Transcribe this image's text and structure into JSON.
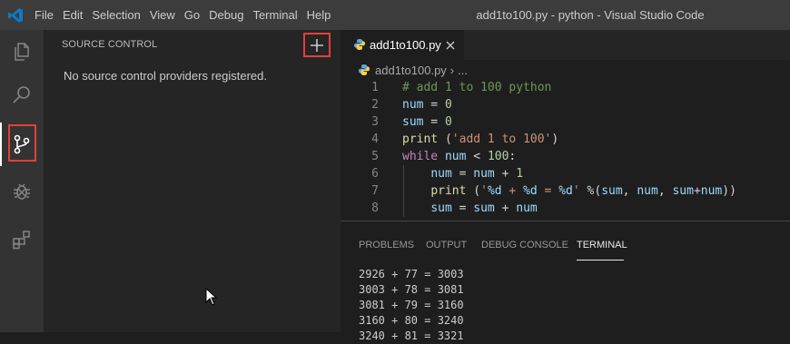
{
  "window": {
    "title": "add1to100.py - python - Visual Studio Code"
  },
  "menu": [
    "File",
    "Edit",
    "Selection",
    "View",
    "Go",
    "Debug",
    "Terminal",
    "Help"
  ],
  "sidebar": {
    "title": "SOURCE CONTROL",
    "message": "No source control providers registered."
  },
  "editor": {
    "tab_label": "add1to100.py",
    "breadcrumb": [
      "add1to100.py",
      "..."
    ],
    "lines": [
      {
        "num": "1",
        "tokens": [
          {
            "t": "# add 1 to 100 python",
            "c": "com"
          }
        ]
      },
      {
        "num": "2",
        "tokens": [
          {
            "t": "num",
            "c": "var"
          },
          {
            "t": " = ",
            "c": "op"
          },
          {
            "t": "0",
            "c": "num"
          }
        ]
      },
      {
        "num": "3",
        "tokens": [
          {
            "t": "sum",
            "c": "var"
          },
          {
            "t": " = ",
            "c": "op"
          },
          {
            "t": "0",
            "c": "num"
          }
        ]
      },
      {
        "num": "4",
        "tokens": [
          {
            "t": "print",
            "c": "fn"
          },
          {
            "t": " (",
            "c": "op"
          },
          {
            "t": "'add 1 to 100'",
            "c": "str"
          },
          {
            "t": ")",
            "c": "op"
          }
        ]
      },
      {
        "num": "5",
        "tokens": [
          {
            "t": "while",
            "c": "kw"
          },
          {
            "t": " ",
            "c": "op"
          },
          {
            "t": "num",
            "c": "var"
          },
          {
            "t": " < ",
            "c": "op"
          },
          {
            "t": "100",
            "c": "num"
          },
          {
            "t": ":",
            "c": "op"
          }
        ]
      },
      {
        "num": "6",
        "tokens": [
          {
            "t": "    ",
            "c": "op"
          },
          {
            "t": "num",
            "c": "var"
          },
          {
            "t": " = ",
            "c": "op"
          },
          {
            "t": "num",
            "c": "var"
          },
          {
            "t": " + ",
            "c": "op"
          },
          {
            "t": "1",
            "c": "num"
          }
        ]
      },
      {
        "num": "7",
        "tokens": [
          {
            "t": "    ",
            "c": "op"
          },
          {
            "t": "print",
            "c": "fn"
          },
          {
            "t": " (",
            "c": "op"
          },
          {
            "t": "'",
            "c": "str"
          },
          {
            "t": "%d",
            "c": "var"
          },
          {
            "t": " + ",
            "c": "str"
          },
          {
            "t": "%d",
            "c": "var"
          },
          {
            "t": " = ",
            "c": "str"
          },
          {
            "t": "%d",
            "c": "var"
          },
          {
            "t": "'",
            "c": "str"
          },
          {
            "t": " %(",
            "c": "op"
          },
          {
            "t": "sum",
            "c": "var"
          },
          {
            "t": ", ",
            "c": "op"
          },
          {
            "t": "num",
            "c": "var"
          },
          {
            "t": ", ",
            "c": "op"
          },
          {
            "t": "sum",
            "c": "var"
          },
          {
            "t": "+",
            "c": "op"
          },
          {
            "t": "num",
            "c": "var"
          },
          {
            "t": "))",
            "c": "op"
          }
        ]
      },
      {
        "num": "8",
        "tokens": [
          {
            "t": "    ",
            "c": "op"
          },
          {
            "t": "sum",
            "c": "var"
          },
          {
            "t": " = ",
            "c": "op"
          },
          {
            "t": "sum",
            "c": "var"
          },
          {
            "t": " + ",
            "c": "op"
          },
          {
            "t": "num",
            "c": "var"
          }
        ]
      }
    ]
  },
  "panel": {
    "tabs": [
      "PROBLEMS",
      "OUTPUT",
      "DEBUG CONSOLE",
      "TERMINAL"
    ],
    "active_tab": "TERMINAL",
    "terminal_lines": [
      "2926 + 77 = 3003",
      "3003 + 78 = 3081",
      "3081 + 79 = 3160",
      "3160 + 80 = 3240",
      "3240 + 81 = 3321"
    ]
  },
  "colors": {
    "accent_highlight": "#e0413a",
    "titlebar": "#3c3c3c",
    "activitybar": "#333333",
    "sidebar": "#252526",
    "editor": "#1e1e1e"
  },
  "icons": [
    "vscode-logo-icon",
    "explorer-icon",
    "search-icon",
    "source-control-icon",
    "debug-icon",
    "extensions-icon",
    "add-icon",
    "python-file-icon",
    "close-icon",
    "mouse-pointer-icon"
  ]
}
